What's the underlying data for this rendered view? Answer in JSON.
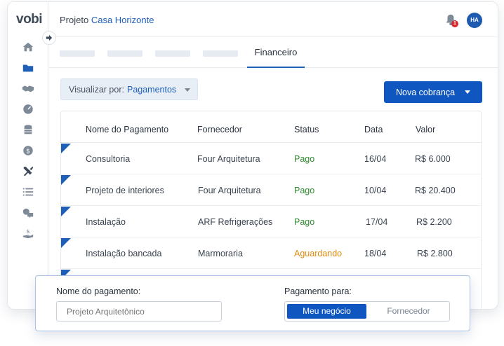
{
  "app": {
    "logo": "vobi"
  },
  "header": {
    "project_prefix": "Projeto",
    "project_name": "Casa Horizonte",
    "notification_count": "1",
    "avatar_initials": "HA"
  },
  "sidebar": {
    "icons": [
      "home-icon",
      "folder-icon",
      "handshake-icon",
      "gauge-icon",
      "coins-icon",
      "dollar-icon",
      "tools-icon",
      "list-icon",
      "chat-icon",
      "payment-hand-icon"
    ]
  },
  "tabs": {
    "active_label": "Financeiro"
  },
  "toolbar": {
    "view_prefix": "Visualizar por:",
    "view_value": "Pagamentos",
    "new_button_label": "Nova cobrança"
  },
  "table": {
    "headers": {
      "name": "Nome do Pagamento",
      "supplier": "Fornecedor",
      "status": "Status",
      "date": "Data",
      "value": "Valor"
    },
    "rows": [
      {
        "name": "Consultoria",
        "supplier": "Four Arquitetura",
        "status": "Pago",
        "date": "16/04",
        "value": "R$ 6.000"
      },
      {
        "name": "Projeto de interiores",
        "supplier": "Four Arquitetura",
        "status": "Pago",
        "date": "10/04",
        "value": "R$ 20.400"
      },
      {
        "name": "Instalação",
        "supplier": "ARF Refrigerações",
        "status": "Pago",
        "date": "17/04",
        "value": "R$ 2.200"
      },
      {
        "name": "Instalação bancada",
        "supplier": "Marmoraria",
        "status": "Aguardando",
        "date": "18/04",
        "value": "R$ 2.800"
      }
    ]
  },
  "colors": {
    "accent": "#0f56c1",
    "paid": "#2e8b2e",
    "waiting": "#e08a0b"
  },
  "form": {
    "name_label": "Nome do pagamento:",
    "name_placeholder": "Projeto Arquitetônico",
    "payment_for_label": "Pagamento para:",
    "option_selected": "Meu negócio",
    "option_other": "Fornecedor"
  }
}
